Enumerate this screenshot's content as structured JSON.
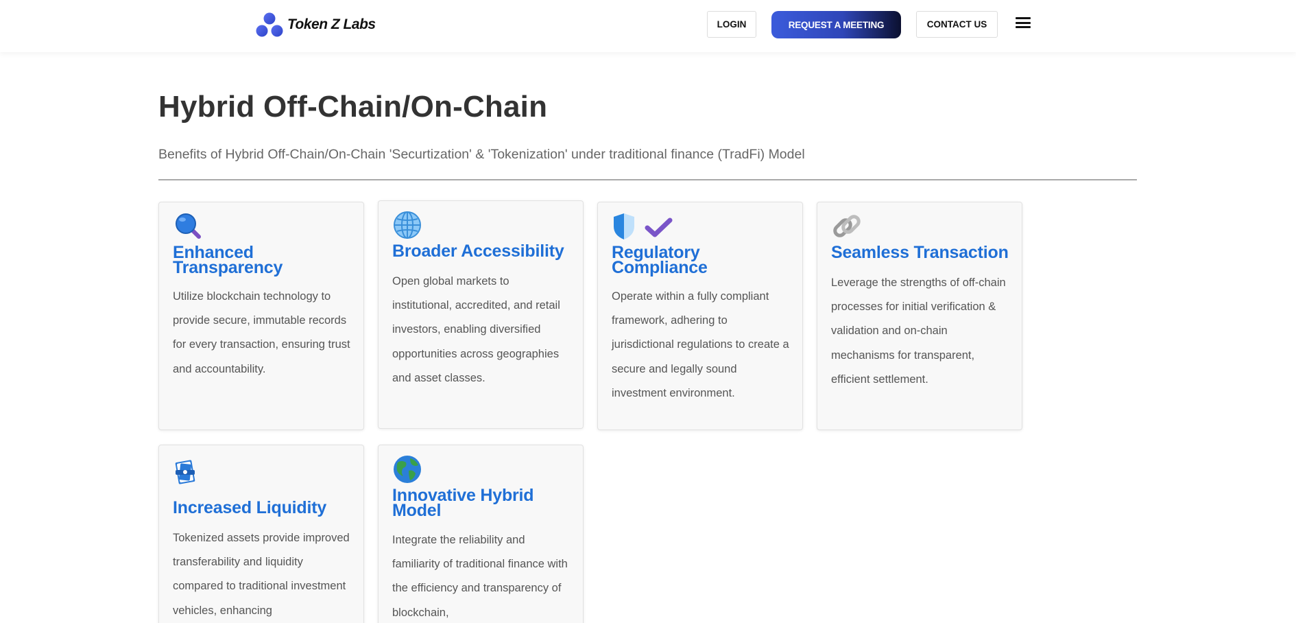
{
  "header": {
    "logo_text": "Token Z Labs",
    "login_label": "LOGIN",
    "meeting_label": "REQUEST A MEETING",
    "contact_label": "CONTACT US"
  },
  "main": {
    "title": "Hybrid Off-Chain/On-Chain",
    "subtitle": "Benefits of Hybrid Off-Chain/On-Chain 'Securtization' & 'Tokenization' under traditional finance (TradFi) Model"
  },
  "cards": [
    {
      "title": "Enhanced Transparency",
      "description": "Utilize blockchain technology to provide secure, immutable records for every transaction, ensuring trust and accountability.",
      "icon": "magnifying-glass-icon"
    },
    {
      "title": "Broader Accessibility",
      "description": "Open global markets to institutional, accredited, and retail investors, enabling diversified opportunities across geographies and asset classes.",
      "icon": "globe-icon"
    },
    {
      "title": "Regulatory Compliance",
      "description": "Operate within a fully compliant framework, adhering to jurisdictional regulations to create a secure and legally sound investment environment.",
      "icon": "shield-check-icon"
    },
    {
      "title": "Seamless Transaction",
      "description": "Leverage the strengths of off-chain processes for initial verification & validation and on-chain mechanisms for transparent, efficient settlement.",
      "icon": "chain-link-icon"
    },
    {
      "title": "Increased Liquidity",
      "description": "Tokenized assets provide improved transferability and liquidity compared to traditional investment vehicles, enhancing",
      "icon": "money-stack-icon"
    },
    {
      "title": "Innovative Hybrid Model",
      "description": "Integrate the reliability and familiarity of traditional finance with the efficiency and transparency of blockchain,",
      "icon": "earth-icon"
    }
  ],
  "colors": {
    "accent": "#1f6fd6",
    "brand_gradient_start": "#3b5bdb",
    "brand_gradient_end": "#0b1030",
    "card_bg": "#f8f8f8"
  }
}
